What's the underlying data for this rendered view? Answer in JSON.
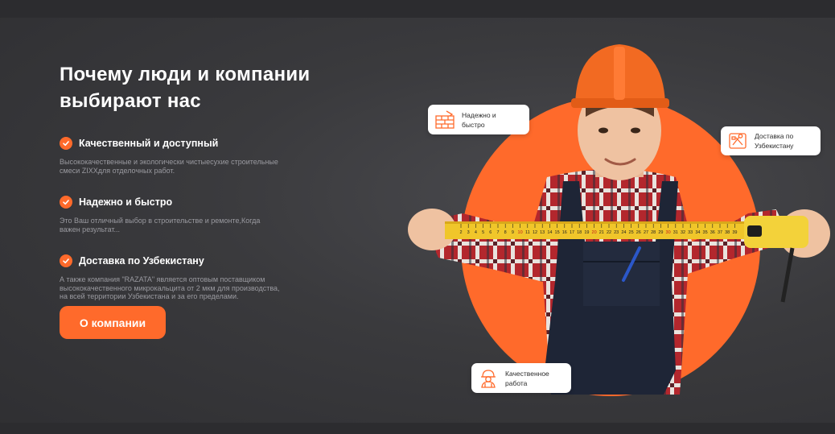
{
  "heading": "Почему люди и компании\nвыбирают нас",
  "features": [
    {
      "title": "Качественный и доступный",
      "description": "Высококачественные и экологически чистыесухие строительные\nсмеси ZIXXдля отделочных работ."
    },
    {
      "title": "Надежно и быстро",
      "description": "Это Ваш отличный выбор в строительстве и ремонте,Когда\nважен результат..."
    },
    {
      "title": "Доставка по Узбекистану",
      "description": "А также компания \"RAZATA\" является оптовым поставщиком\nвысококачественного микрокальцита от 2 мкм для производства,\nна всей территории Узбекистана и за его пределами."
    }
  ],
  "cta_label": "О компании",
  "cards": {
    "reliable": "Надежно и\nбыстро",
    "delivery": "Доставка по\nУзбекистану",
    "quality": "Качественное\nработа"
  },
  "tape_numbers": [
    "2",
    "3",
    "4",
    "5",
    "6",
    "7",
    "8",
    "9",
    "10",
    "11",
    "12",
    "13",
    "14",
    "15",
    "16",
    "17",
    "18",
    "19",
    "20",
    "21",
    "22",
    "23",
    "24",
    "25",
    "26",
    "27",
    "28",
    "29",
    "30",
    "31",
    "32",
    "33",
    "34",
    "35",
    "36",
    "37",
    "38",
    "39"
  ],
  "colors": {
    "accent": "#ff6a2b",
    "background": "#3a3a3d",
    "muted_text": "#9a9aa0"
  }
}
